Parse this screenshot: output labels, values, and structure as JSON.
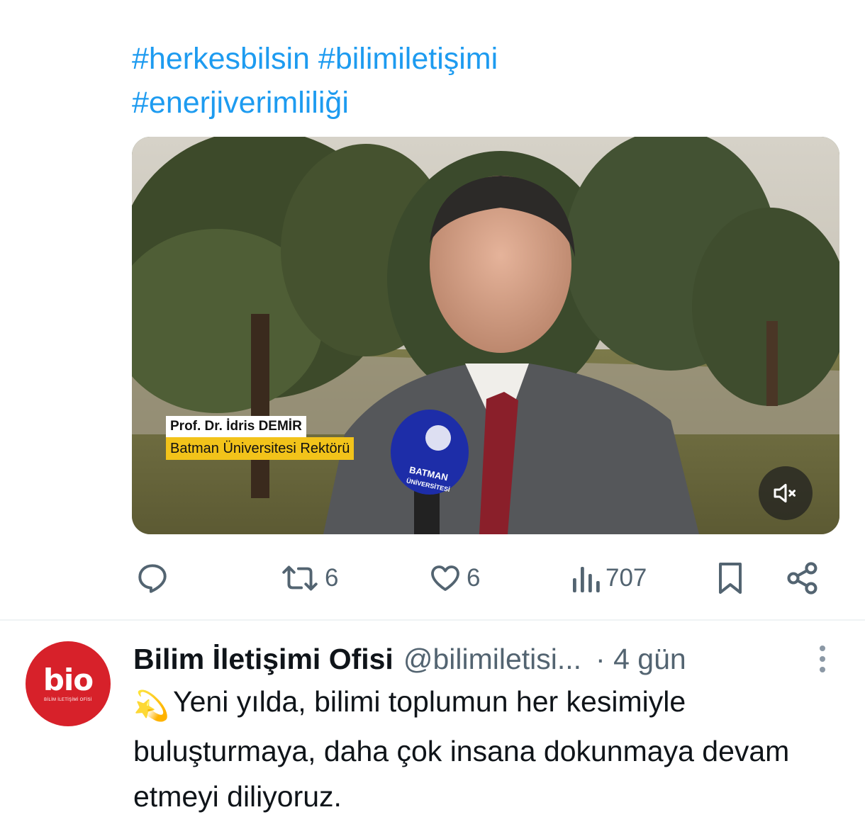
{
  "post": {
    "hashtags": [
      "#herkesbilsin",
      "#bilimiletişimi",
      "#enerjiverimliliği"
    ],
    "video": {
      "lower_third_name": "Prof. Dr. İdris DEMİR",
      "lower_third_title": "Batman Üniversitesi Rektörü",
      "mic_text_1": "BATMAN",
      "mic_text_2": "ÜNİVERSİTESİ",
      "muted": true
    },
    "actions": {
      "reply_count": "",
      "retweet_count": "6",
      "like_count": "6",
      "views_count": "707"
    }
  },
  "next_post": {
    "author_name": "Bilim İletişimi Ofisi",
    "handle": "@bilimiletisi...",
    "time": "· 4 gün",
    "avatar_text": "bio",
    "avatar_subtext": "BİLİM İLETİŞİMİ OFİSİ",
    "emoji": "💫",
    "text": "Yeni yılda, bilimi toplumun her kesimiyle buluşturmaya, daha çok insana dokunmaya devam etmeyi diliyoruz."
  },
  "colors": {
    "link": "#1d9bf0",
    "secondary": "#536471",
    "avatar_bg": "#d7212a",
    "lower_third_yellow": "#f2c31a"
  },
  "icons": {
    "reply": "reply-icon",
    "retweet": "retweet-icon",
    "like": "heart-icon",
    "views": "views-icon",
    "bookmark": "bookmark-icon",
    "share": "share-icon",
    "mute": "volume-mute-icon",
    "more": "more-vertical-icon"
  }
}
